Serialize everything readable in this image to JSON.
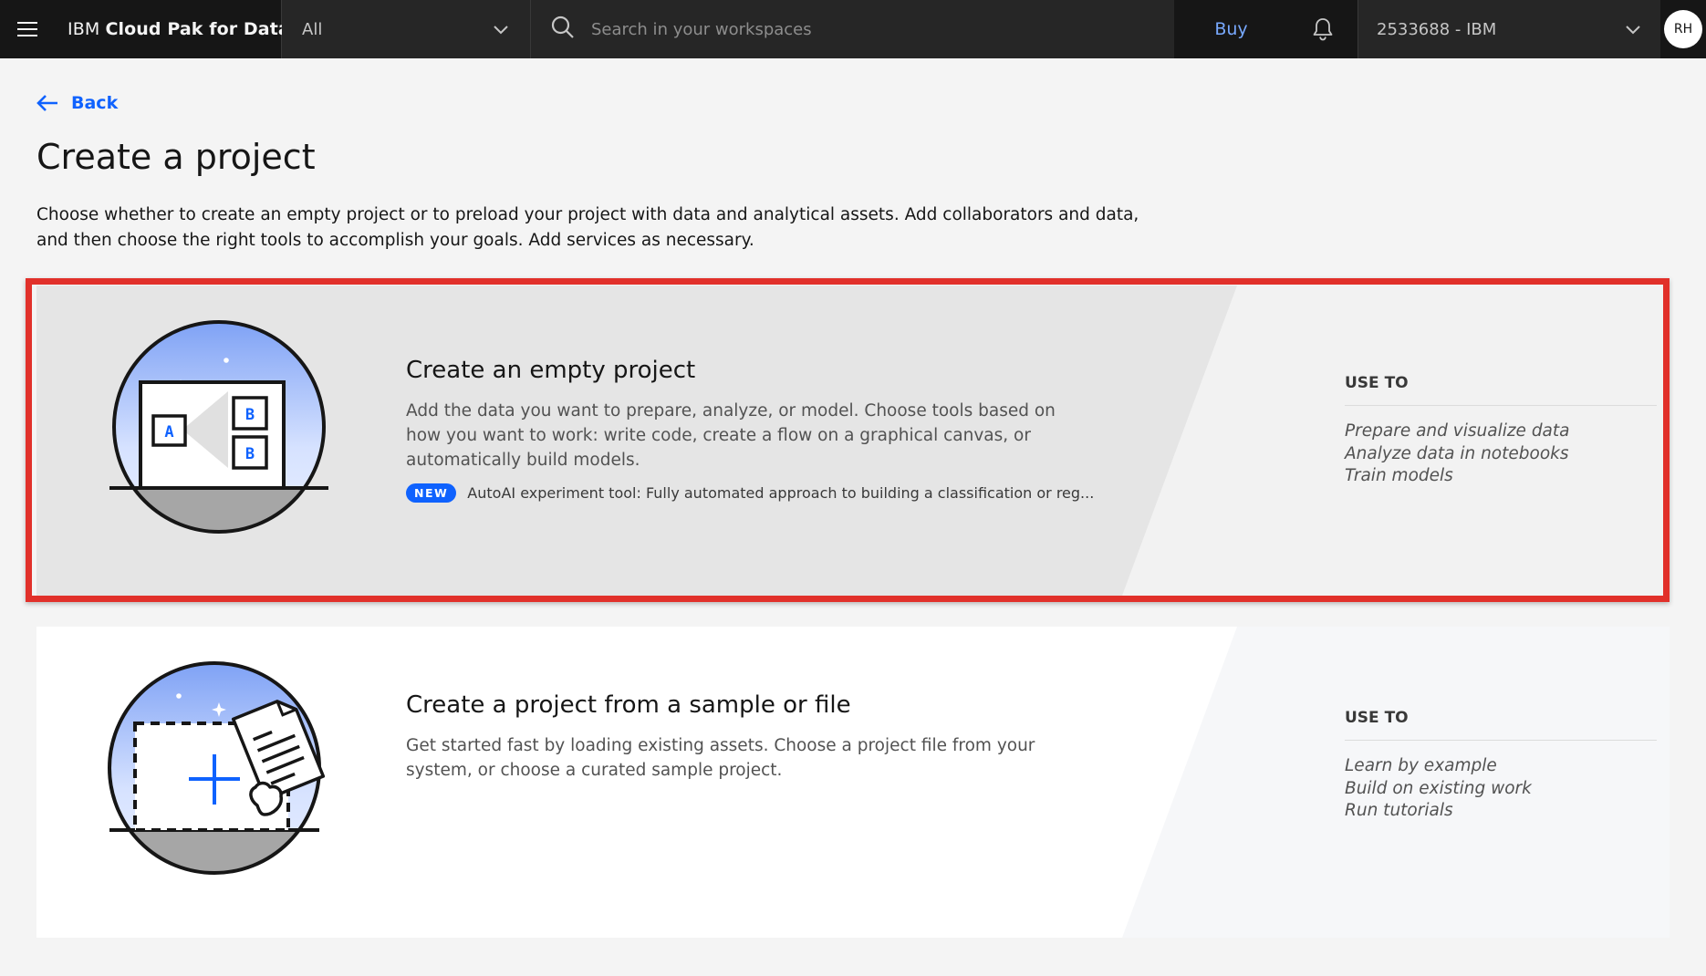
{
  "header": {
    "menu_icon": "hamburger-menu-icon",
    "brand_prefix": "IBM",
    "brand_name": "Cloud Pak for Data",
    "scope_value": "All",
    "search_placeholder": "Search in your workspaces",
    "buy_label": "Buy",
    "notification_icon": "bell-icon",
    "account_label": "2533688 - IBM",
    "avatar_initials": "RH"
  },
  "page": {
    "back_label": "Back",
    "title": "Create a project",
    "description": "Choose whether to create an empty project or to preload your project with data and analytical assets. Add collaborators and data, and then choose the right tools to accomplish your goals. Add services as necessary."
  },
  "cards": [
    {
      "title": "Create an empty project",
      "description": "Add the data you want to prepare, analyze, or model. Choose tools based on how you want to work: write code, create a flow on a graphical canvas, or automatically build models.",
      "badge": "NEW",
      "badge_text": "AutoAI experiment tool: Fully automated approach to building a classification or reg...",
      "use_to_label": "USE TO",
      "use_to_items": [
        "Prepare and visualize data",
        "Analyze data in notebooks",
        "Train models"
      ],
      "highlighted": true
    },
    {
      "title": "Create a project from a sample or file",
      "description": "Get started fast by loading existing assets. Choose a project file from your system, or choose a curated sample project.",
      "use_to_label": "USE TO",
      "use_to_items": [
        "Learn by example",
        "Build on existing work",
        "Run tutorials"
      ],
      "highlighted": false
    }
  ],
  "colors": {
    "header_bg": "#161616",
    "accent_blue": "#0f62fe",
    "link_blue": "#78a9ff",
    "highlight_red": "#e1302a",
    "page_bg": "#f4f4f4"
  }
}
